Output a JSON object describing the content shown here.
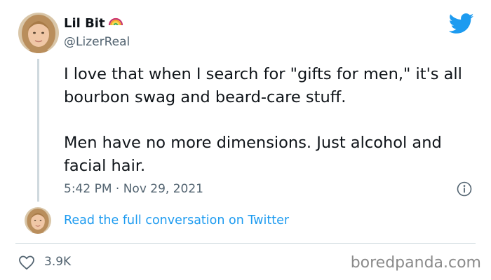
{
  "tweet": {
    "author": {
      "display_name": "Lil Bit",
      "badge_emoji_icon": "rainbow-icon",
      "handle": "@LizerReal"
    },
    "paragraphs": [
      "I love that when I search for \"gifts for men,\" it's all bourbon swag and beard-care stuff.",
      "Men have no more dimensions. Just alcohol and facial hair."
    ],
    "timestamp": "5:42 PM · Nov 29, 2021",
    "read_more_label": "Read the full conversation on Twitter",
    "likes": "3.9K"
  },
  "footer": {
    "watermark": "boredpanda.com"
  },
  "colors": {
    "twitter_blue": "#1d9bf0",
    "muted_text": "#536471",
    "divider": "#cfd9de"
  }
}
